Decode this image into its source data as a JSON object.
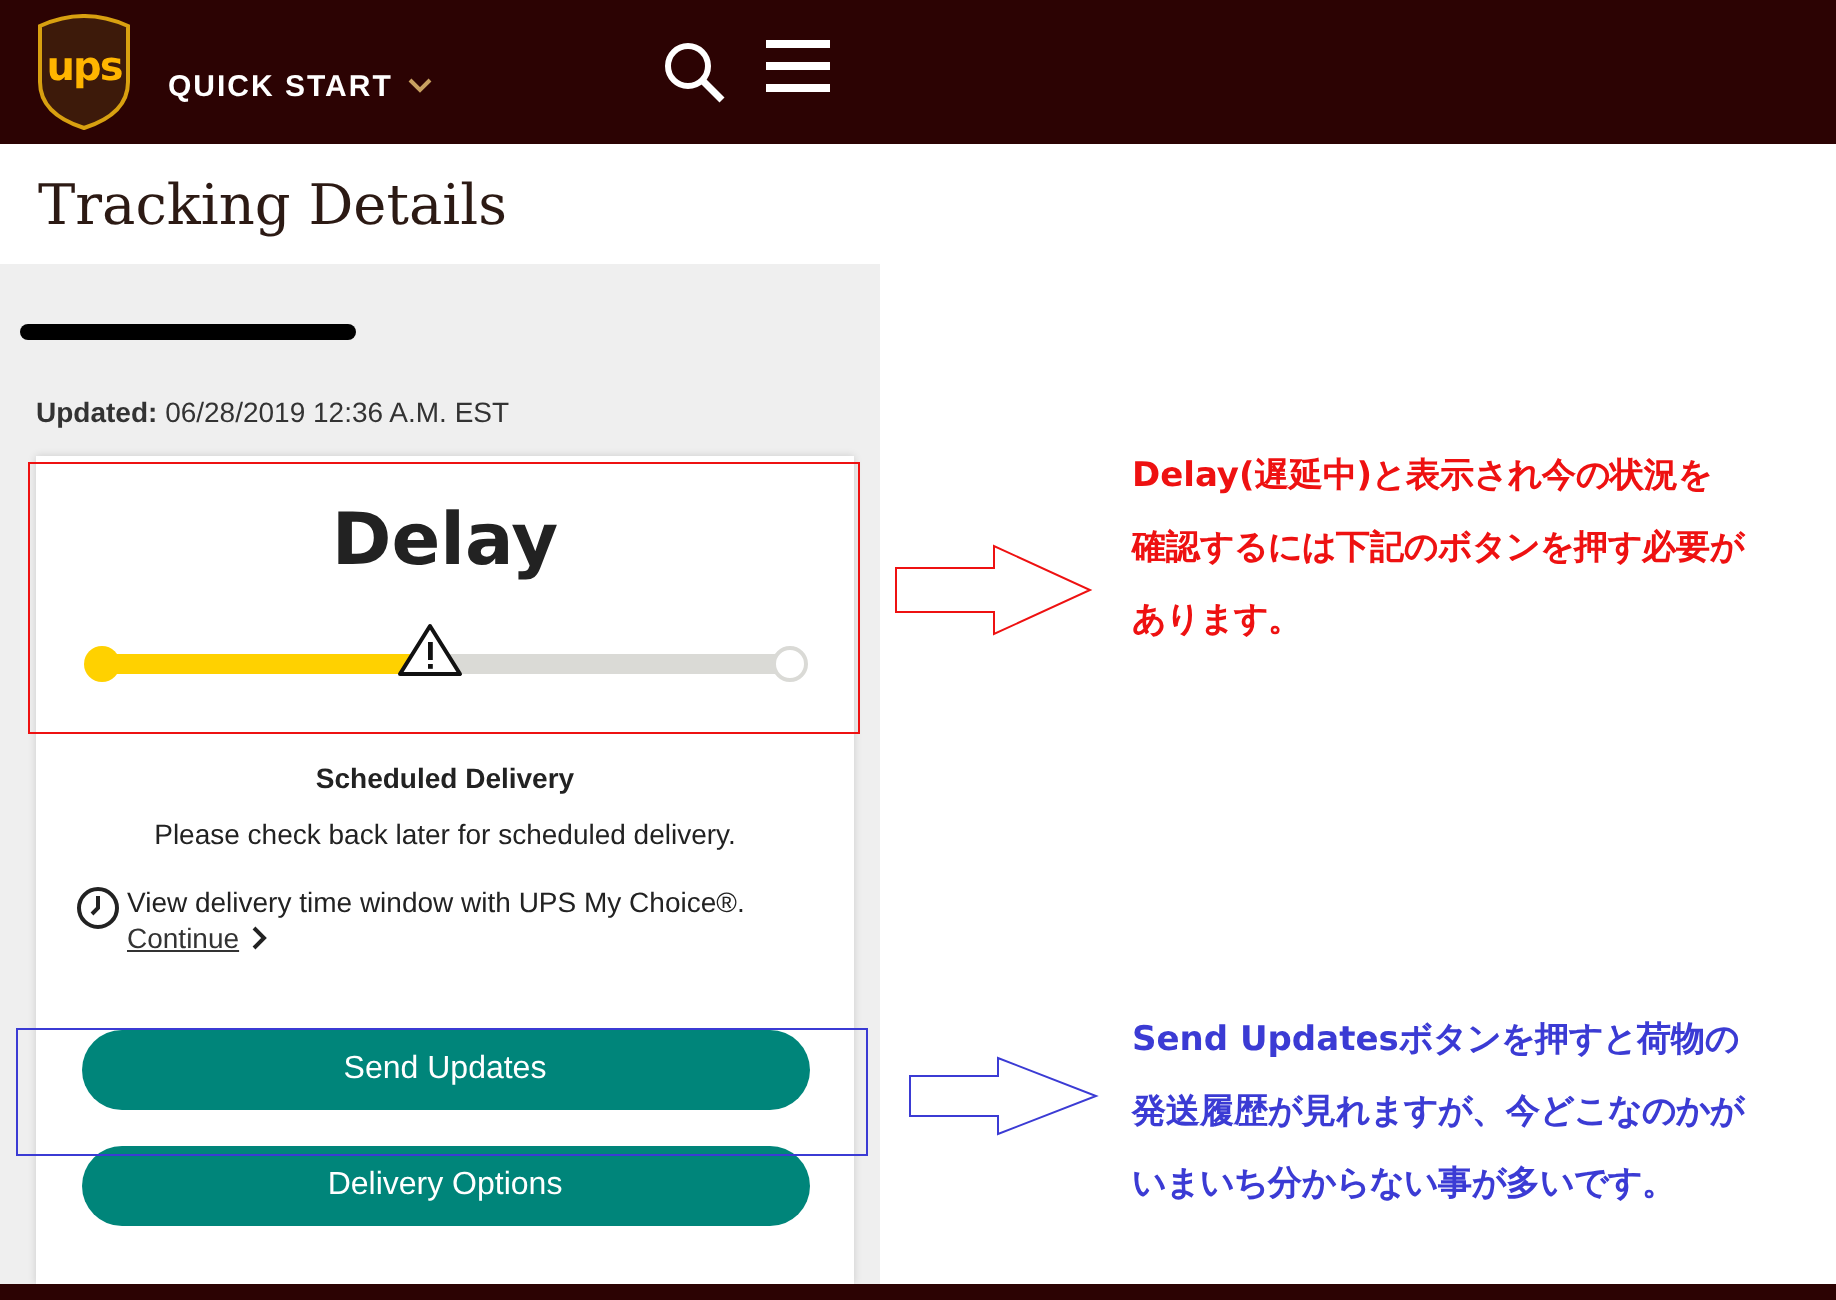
{
  "header": {
    "logo_text": "ups",
    "menu_label": "QUICK START"
  },
  "page_title": "Tracking Details",
  "tracking": {
    "updated_label": "Updated:",
    "updated_value": "06/28/2019 12:36 A.M. EST"
  },
  "status": {
    "title": "Delay",
    "level": 0.48
  },
  "delivery": {
    "heading": "Scheduled Delivery",
    "message": "Please check back later for scheduled delivery.",
    "note": "View delivery time window with UPS My Choice®.",
    "link": "Continue"
  },
  "buttons": [
    {
      "label": "Send Updates"
    },
    {
      "label": "Delivery Options"
    }
  ],
  "annotations": [
    {
      "text": "Delay(遅延中)と表示され今の状況を確認するには下記のボタンを押す必要があります。",
      "color": "#ee1111"
    },
    {
      "text": "Send Updatesボタンを押すと荷物の発送履歴が見れますが、今どこなのかがいまいち分からない事が多いです。",
      "color": "#3b3bd4"
    }
  ]
}
